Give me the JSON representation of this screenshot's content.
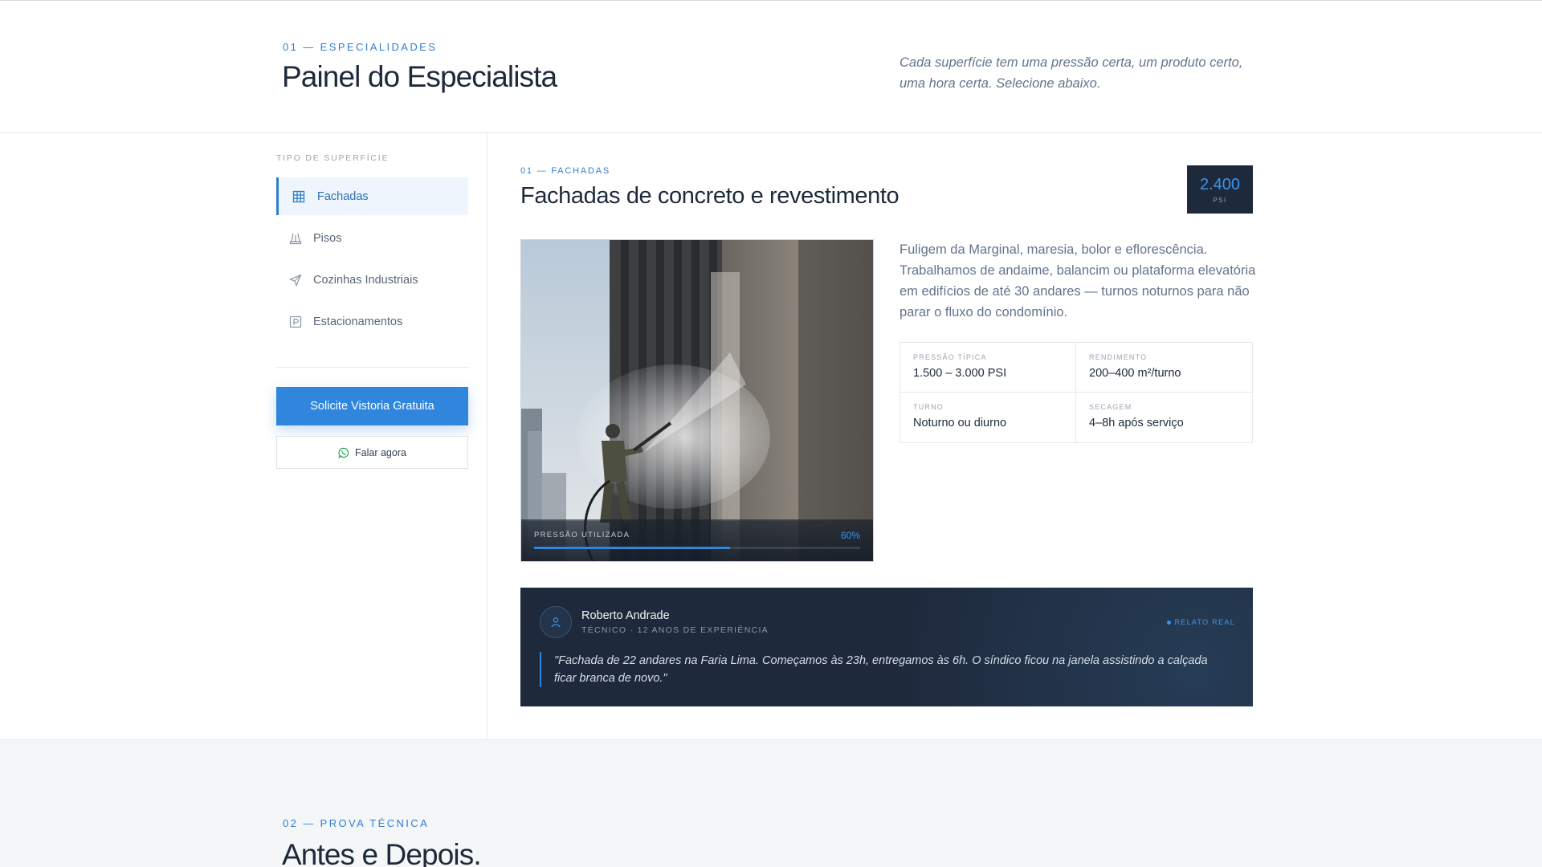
{
  "header": {
    "eyebrow": "01 — ESPECIALIDADES",
    "title": "Painel do Especialista",
    "subtitle": "Cada superfície tem uma pressão certa, um produto certo, uma hora certa. Selecione abaixo."
  },
  "sidebar": {
    "label": "TIPO DE SUPERFÍCIE",
    "items": [
      {
        "label": "Fachadas",
        "icon": "building-icon",
        "active": true
      },
      {
        "label": "Pisos",
        "icon": "floor-icon",
        "active": false
      },
      {
        "label": "Cozinhas Industriais",
        "icon": "send-icon",
        "active": false
      },
      {
        "label": "Estacionamentos",
        "icon": "parking-icon",
        "active": false
      }
    ],
    "cta_primary": "Solicite Vistoria Gratuita",
    "cta_secondary": "Falar agora"
  },
  "main": {
    "eyebrow": "01 — FACHADAS",
    "title": "Fachadas de concreto e revestimento",
    "psi": {
      "value": "2.400",
      "unit": "PSI"
    },
    "description": "Fuligem da Marginal, maresia, bolor e eflorescência. Trabalhamos de andaime, balancim ou plataforma elevatória em edifícios de até 30 andares — turnos noturnos para não parar o fluxo do condomínio.",
    "pressure": {
      "label": "PRESSÃO UTILIZADA",
      "value_text": "60%",
      "value": 0.6
    },
    "stats": [
      {
        "key": "PRESSÃO TÍPICA",
        "value": "1.500 – 3.000 PSI"
      },
      {
        "key": "RENDIMENTO",
        "value": "200–400 m²/turno"
      },
      {
        "key": "TURNO",
        "value": "Noturno ou diurno"
      },
      {
        "key": "SECAGEM",
        "value": "4–8h após serviço"
      }
    ],
    "testimonial": {
      "name": "Roberto Andrade",
      "role": "TÉCNICO · 12 ANOS DE EXPERIÊNCIA",
      "tag": "RELATO REAL",
      "quote": "\"Fachada de 22 andares na Faria Lima. Começamos às 23h, entregamos às 6h. O síndico ficou na janela assistindo a calçada ficar branca de novo.\""
    }
  },
  "next_section": {
    "eyebrow": "02 — PROVA TÉCNICA",
    "title": "Antes e Depois."
  },
  "colors": {
    "accent": "#2f86dc",
    "dark": "#1e293b",
    "muted": "#64748b"
  }
}
